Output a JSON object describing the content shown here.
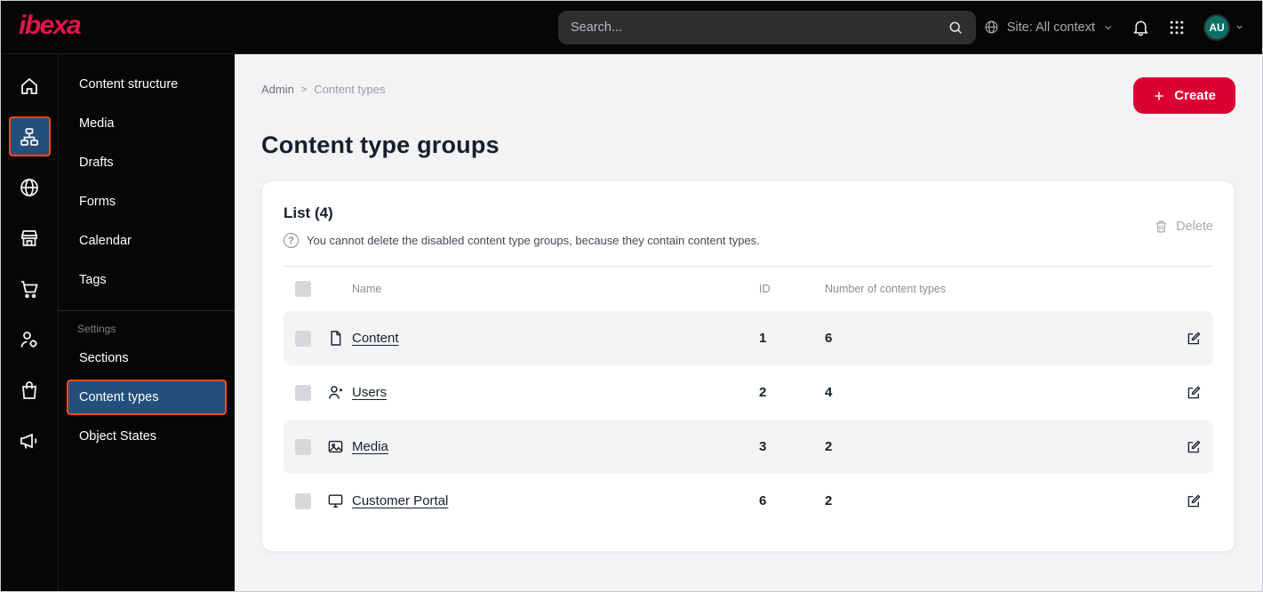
{
  "colors": {
    "accent_red": "#dc0032",
    "accent_orange": "#ff4713",
    "active_blue": "#234f7d",
    "avatar_teal": "#0d6e62"
  },
  "topbar": {
    "logo": "ibexa",
    "search_placeholder": "Search...",
    "site_context_label": "Site: All context",
    "avatar_initials": "AU"
  },
  "icon_sidebar": {
    "items": [
      {
        "icon": "home-icon",
        "active": false
      },
      {
        "icon": "content-structure-icon",
        "active": true
      },
      {
        "icon": "site-globe-icon",
        "active": false
      },
      {
        "icon": "storefront-icon",
        "active": false
      },
      {
        "icon": "commerce-cart-icon",
        "active": false
      },
      {
        "icon": "permissions-user-icon",
        "active": false
      },
      {
        "icon": "catalog-bag-icon",
        "active": false
      },
      {
        "icon": "marketing-megaphone-icon",
        "active": false
      }
    ]
  },
  "sidebar": {
    "items": [
      {
        "label": "Content structure"
      },
      {
        "label": "Media"
      },
      {
        "label": "Drafts"
      },
      {
        "label": "Forms"
      },
      {
        "label": "Calendar"
      },
      {
        "label": "Tags"
      }
    ],
    "settings_heading": "Settings",
    "settings_items": [
      {
        "label": "Sections"
      },
      {
        "label": "Content types",
        "active": true
      },
      {
        "label": "Object States"
      }
    ]
  },
  "main": {
    "breadcrumb": {
      "root": "Admin",
      "separator": ">",
      "current": "Content types"
    },
    "create_button": "Create",
    "page_title": "Content type groups",
    "list": {
      "title": "List (4)",
      "help_text": "You cannot delete the disabled content type groups, because they contain content types.",
      "delete_button": "Delete",
      "columns": {
        "name": "Name",
        "id": "ID",
        "count": "Number of content types"
      },
      "rows": [
        {
          "name": "Content",
          "id": "1",
          "count": "6",
          "icon": "content-file-icon"
        },
        {
          "name": "Users",
          "id": "2",
          "count": "4",
          "icon": "users-person-icon"
        },
        {
          "name": "Media",
          "id": "3",
          "count": "2",
          "icon": "media-image-icon"
        },
        {
          "name": "Customer Portal",
          "id": "6",
          "count": "2",
          "icon": "customer-portal-monitor-icon"
        }
      ]
    }
  }
}
